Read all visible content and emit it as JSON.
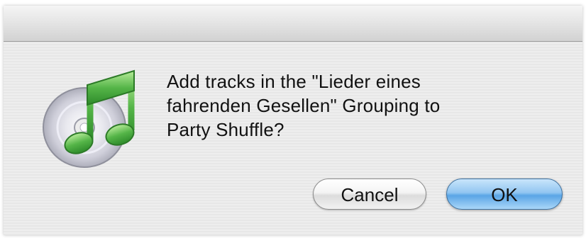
{
  "dialog": {
    "message": "Add tracks in the \"Lieder eines fahrenden Gesellen\" Grouping to Party Shuffle?",
    "message_lines": [
      "Add tracks in the \"Lieder eines",
      "fahrenden Gesellen\" Grouping to",
      "Party Shuffle?"
    ],
    "icon": "itunes-icon",
    "buttons": {
      "cancel_label": "Cancel",
      "ok_label": "OK"
    }
  },
  "colors": {
    "dialog_background": "#ececec",
    "default_button": "#6cb4ee",
    "note_green": "#55b548"
  }
}
